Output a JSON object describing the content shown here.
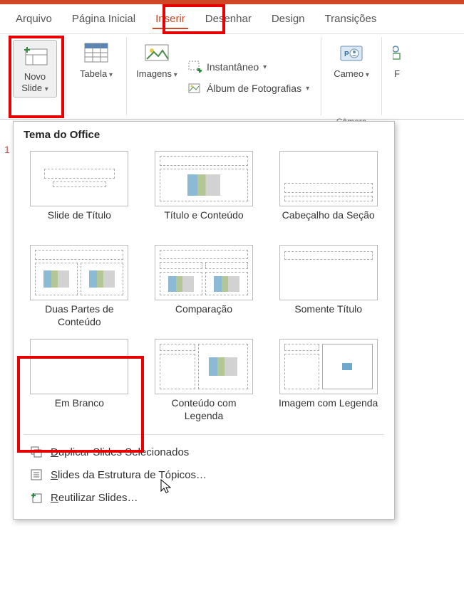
{
  "tabs": {
    "arquivo": "Arquivo",
    "pagina_inicial": "Página Inicial",
    "inserir": "Inserir",
    "desenhar": "Desenhar",
    "design": "Design",
    "transicoes": "Transições"
  },
  "ribbon": {
    "novo_slide": "Novo\nSlide",
    "tabela": "Tabela",
    "imagens": "Imagens",
    "instantaneo": "Instantâneo",
    "album": "Álbum de Fotografias",
    "cameo": "Cameo",
    "camera": "Câmera",
    "f_partial": "F"
  },
  "dropdown": {
    "heading": "Tema do Office",
    "layouts": [
      "Slide de Título",
      "Título e Conteúdo",
      "Cabeçalho da Seção",
      "Duas Partes de Conteúdo",
      "Comparação",
      "Somente Título",
      "Em Branco",
      "Conteúdo com Legenda",
      "Imagem com Legenda"
    ],
    "actions": {
      "duplicar_pre": "D",
      "duplicar_rest": "uplicar Slides Selecionados",
      "estrutura_pre": "S",
      "estrutura_rest": "lides da Estrutura de Tópicos…",
      "reutilizar_pre": "R",
      "reutilizar_rest": "eutilizar Slides…"
    }
  },
  "slide_number": "1"
}
